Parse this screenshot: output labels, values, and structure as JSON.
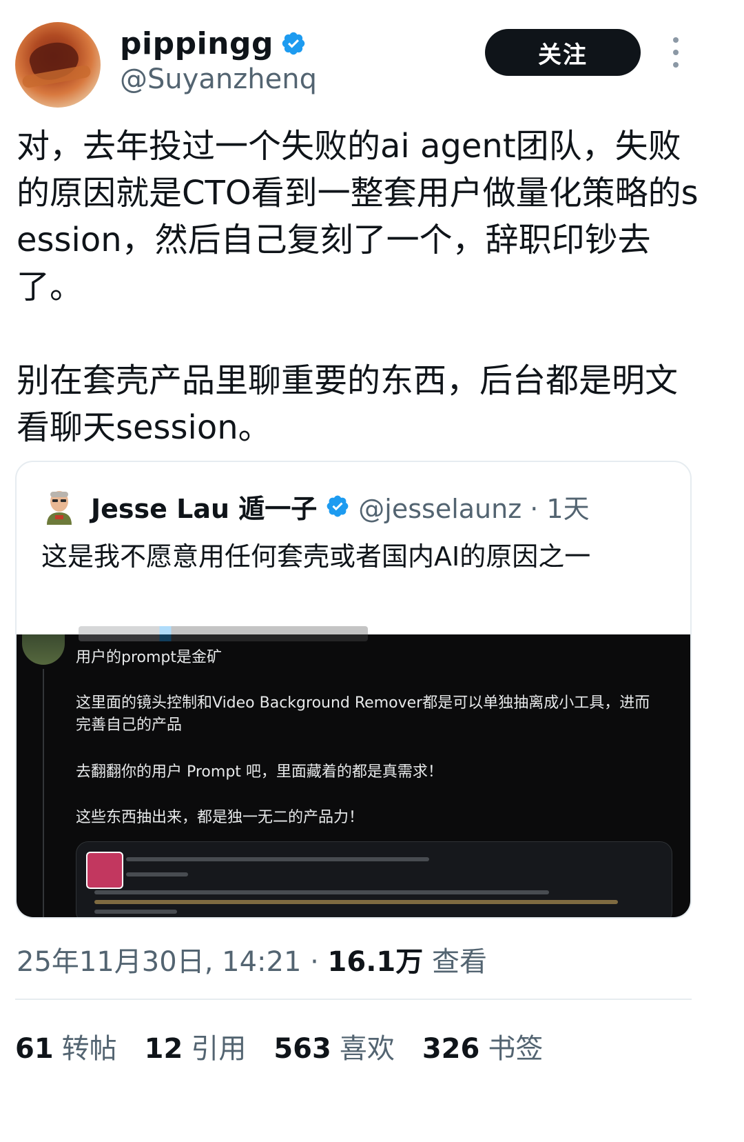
{
  "author": {
    "display_name": "pippingg",
    "handle": "@Suyanzhenq",
    "follow_label": "关注"
  },
  "tweet": {
    "text": "对，去年投过一个失败的ai agent团队，失败的原因就是CTO看到一整套用户做量化策略的session，然后自己复刻了一个，辞职印钞去了。\n\n别在套壳产品里聊重要的东西，后台都是明文看聊天session。"
  },
  "quote": {
    "display_name": "Jesse Lau 遁一子",
    "handle_time": "@jesselaunz · 1天",
    "text": "这是我不愿意用任何套壳或者国内AI的原因之一",
    "embedded": {
      "line1": "用户的prompt是金矿",
      "line2": "这里面的镜头控制和Video Background Remover都是可以单独抽离成小工具，进而完善自己的产品",
      "line3": "去翻翻你的用户 Prompt 吧，里面藏着的都是真需求！",
      "line4": "这些东西抽出来，都是独一无二的产品力！"
    }
  },
  "meta": {
    "timestamp": "25年11月30日, 14:21 · ",
    "views_count": "16.1万",
    "views_label": " 查看"
  },
  "stats": {
    "reposts_num": "61",
    "reposts_label": "转帖",
    "quotes_num": "12",
    "quotes_label": "引用",
    "likes_num": "563",
    "likes_label": "喜欢",
    "bookmarks_num": "326",
    "bookmarks_label": "书签"
  },
  "icons": {
    "verified": "verified-badge-icon",
    "more": "more-options-icon"
  },
  "colors": {
    "verified_blue": "#1d9bf0",
    "secondary_text": "#536471",
    "follow_button_bg": "#0f1419"
  }
}
